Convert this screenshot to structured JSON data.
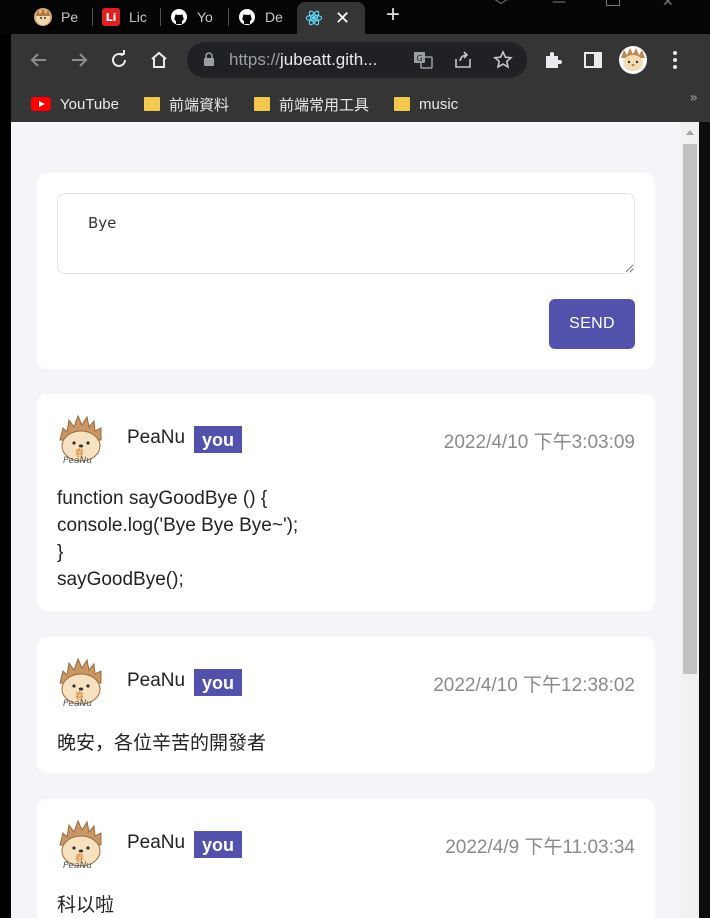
{
  "browser": {
    "tabs": [
      {
        "label": "Pe",
        "favicon": "peanu-avatar-icon"
      },
      {
        "label": "Lic",
        "favicon": "li-logo-icon",
        "badge_text": "Li"
      },
      {
        "label": "Yo",
        "favicon": "github-icon"
      },
      {
        "label": "De",
        "favicon": "github-icon"
      },
      {
        "label": "",
        "favicon": "react-icon",
        "active": true
      }
    ],
    "url_prefix": "https://",
    "url_host": "jubeatt.gith...",
    "bookmarks": [
      {
        "label": "YouTube",
        "icon": "youtube-icon"
      },
      {
        "label": "前端資料",
        "icon": "folder-icon"
      },
      {
        "label": "前端常用工具",
        "icon": "folder-icon"
      },
      {
        "label": "music",
        "icon": "folder-icon"
      }
    ],
    "bookmarks_more": "»"
  },
  "composer": {
    "value": "Bye",
    "send_label": "SEND"
  },
  "posts": [
    {
      "author": "PeaNu",
      "badge": "you",
      "time": "2022/4/10 下午3:03:09",
      "content": "function sayGoodBye () {\nconsole.log('Bye Bye Bye~');\n}\nsayGoodBye();"
    },
    {
      "author": "PeaNu",
      "badge": "you",
      "time": "2022/4/10 下午12:38:02",
      "content": "晚安，各位辛苦的開發者"
    },
    {
      "author": "PeaNu",
      "badge": "you",
      "time": "2022/4/9 下午11:03:34",
      "content": "科以啦"
    }
  ],
  "colors": {
    "accent": "#5252ad",
    "page_bg": "#f5f5f9",
    "card_bg": "#ffffff",
    "chrome_bg": "#353535"
  }
}
